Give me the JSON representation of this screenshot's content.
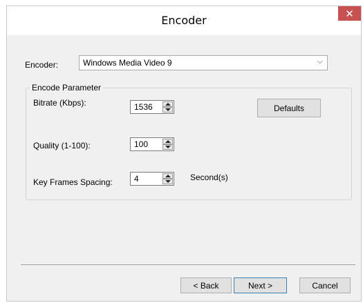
{
  "window": {
    "title": "Encoder",
    "close_glyph": "✕"
  },
  "encoder": {
    "label": "Encoder:",
    "selected": "Windows Media Video 9",
    "arrow_glyph": "⌵"
  },
  "group": {
    "title": "Encode Parameter",
    "bitrate": {
      "label": "Bitrate (Kbps):",
      "value": "1536"
    },
    "quality": {
      "label": "Quality (1-100):",
      "value": "100"
    },
    "keyframes": {
      "label": "Key Frames Spacing:",
      "value": "4",
      "unit": "Second(s)"
    },
    "defaults_label": "Defaults"
  },
  "footer": {
    "back_label": "< Back",
    "next_label": "Next >",
    "cancel_label": "Cancel"
  },
  "colors": {
    "close_bg": "#c75050",
    "dialog_bg": "#f0f0f0",
    "primary_border": "#3c7fb1"
  }
}
